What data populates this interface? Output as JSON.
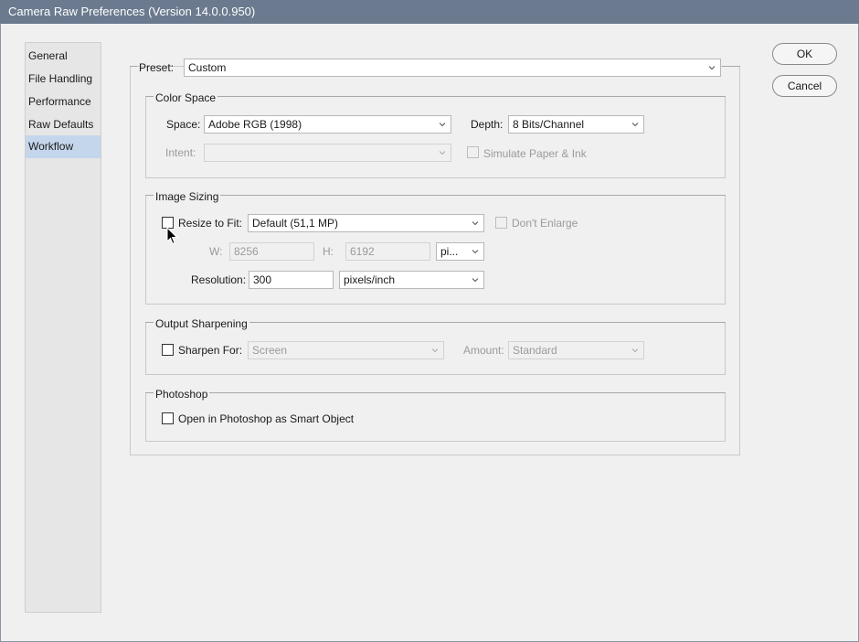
{
  "window": {
    "title": "Camera Raw Preferences  (Version 14.0.0.950)"
  },
  "sidebar": {
    "items": [
      {
        "label": "General"
      },
      {
        "label": "File Handling"
      },
      {
        "label": "Performance"
      },
      {
        "label": "Raw Defaults"
      },
      {
        "label": "Workflow",
        "selected": true
      }
    ]
  },
  "buttons": {
    "ok": "OK",
    "cancel": "Cancel"
  },
  "preset": {
    "label": "Preset:",
    "value": "Custom"
  },
  "color_space": {
    "title": "Color Space",
    "space_label": "Space:",
    "space_value": "Adobe RGB (1998)",
    "depth_label": "Depth:",
    "depth_value": "8 Bits/Channel",
    "intent_label": "Intent:",
    "intent_value": "",
    "simulate_label": "Simulate Paper & Ink"
  },
  "image_sizing": {
    "title": "Image Sizing",
    "resize_label": "Resize to Fit:",
    "resize_value": "Default  (51,1 MP)",
    "dont_enlarge_label": "Don't Enlarge",
    "w_label": "W:",
    "w_value": "8256",
    "h_label": "H:",
    "h_value": "6192",
    "unit_value": "pi...",
    "resolution_label": "Resolution:",
    "resolution_value": "300",
    "resolution_unit": "pixels/inch"
  },
  "output_sharpening": {
    "title": "Output Sharpening",
    "sharpen_label": "Sharpen For:",
    "sharpen_value": "Screen",
    "amount_label": "Amount:",
    "amount_value": "Standard"
  },
  "photoshop": {
    "title": "Photoshop",
    "smart_object_label": "Open in Photoshop as Smart Object"
  },
  "colors": {
    "titlebar": "#6b7a8f",
    "selection": "#c4d6ec",
    "background": "#f0f0f0"
  }
}
